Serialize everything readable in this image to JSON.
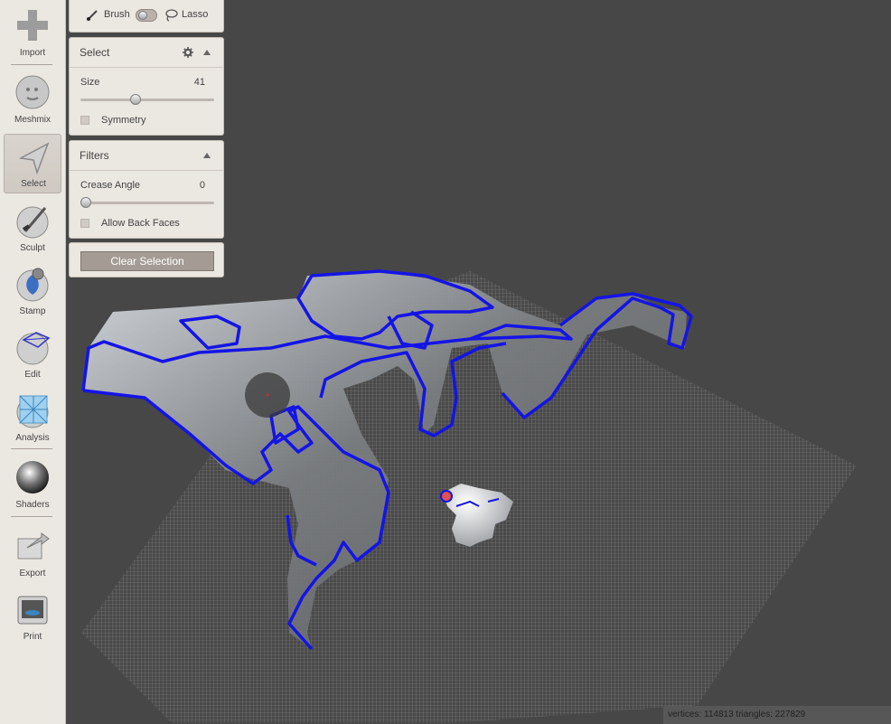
{
  "toolbar": {
    "items": [
      {
        "label": "Import",
        "icon": "plus-icon"
      },
      {
        "label": "Meshmix",
        "icon": "meshmix-icon"
      },
      {
        "label": "Select",
        "icon": "select-arrow-icon",
        "active": true
      },
      {
        "label": "Sculpt",
        "icon": "brush-icon"
      },
      {
        "label": "Stamp",
        "icon": "stamp-icon"
      },
      {
        "label": "Edit",
        "icon": "edit-icon"
      },
      {
        "label": "Analysis",
        "icon": "analysis-icon"
      },
      {
        "label": "Shaders",
        "icon": "shaders-icon"
      },
      {
        "label": "Export",
        "icon": "export-icon"
      },
      {
        "label": "Print",
        "icon": "printer-icon"
      }
    ]
  },
  "mode": {
    "brush_label": "Brush",
    "lasso_label": "Lasso",
    "selected": "Brush"
  },
  "select_panel": {
    "title": "Select",
    "size_label": "Size",
    "size_value": "41",
    "size_fraction": 0.41,
    "symmetry_label": "Symmetry",
    "symmetry_checked": false
  },
  "filters_panel": {
    "title": "Filters",
    "crease_label": "Crease Angle",
    "crease_value": "0",
    "crease_fraction": 0,
    "back_faces_label": "Allow Back Faces",
    "back_faces_checked": false
  },
  "actions": {
    "clear_selection": "Clear Selection"
  },
  "status": {
    "text": "vertices: 114813 triangles: 227829"
  },
  "colors": {
    "viewport_bg": "#474747",
    "panel_bg": "#ebe7e1",
    "selection_outline": "#1414e6"
  }
}
